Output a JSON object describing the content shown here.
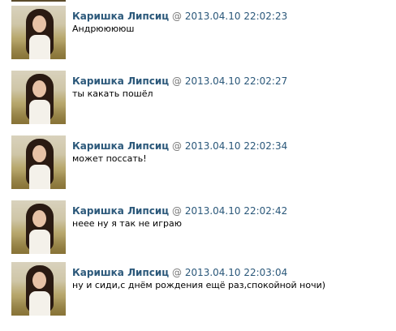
{
  "chat": {
    "separator": "@",
    "messages": [
      {
        "author": "Каришка Липсиц",
        "timestamp": "2013.04.10 22:02:23",
        "text": "Андрююююш"
      },
      {
        "author": "Каришка Липсиц",
        "timestamp": "2013.04.10 22:02:27",
        "text": "ты какать пошёл"
      },
      {
        "author": "Каришка Липсиц",
        "timestamp": "2013.04.10 22:02:34",
        "text": "может поссать!"
      },
      {
        "author": "Каришка Липсиц",
        "timestamp": "2013.04.10 22:02:42",
        "text": "неее ну я так не играю"
      },
      {
        "author": "Каришка Липсиц",
        "timestamp": "2013.04.10 22:03:04",
        "text": "ну и сиди,с днём рождения ещё раз,спокойной ночи)"
      }
    ]
  }
}
